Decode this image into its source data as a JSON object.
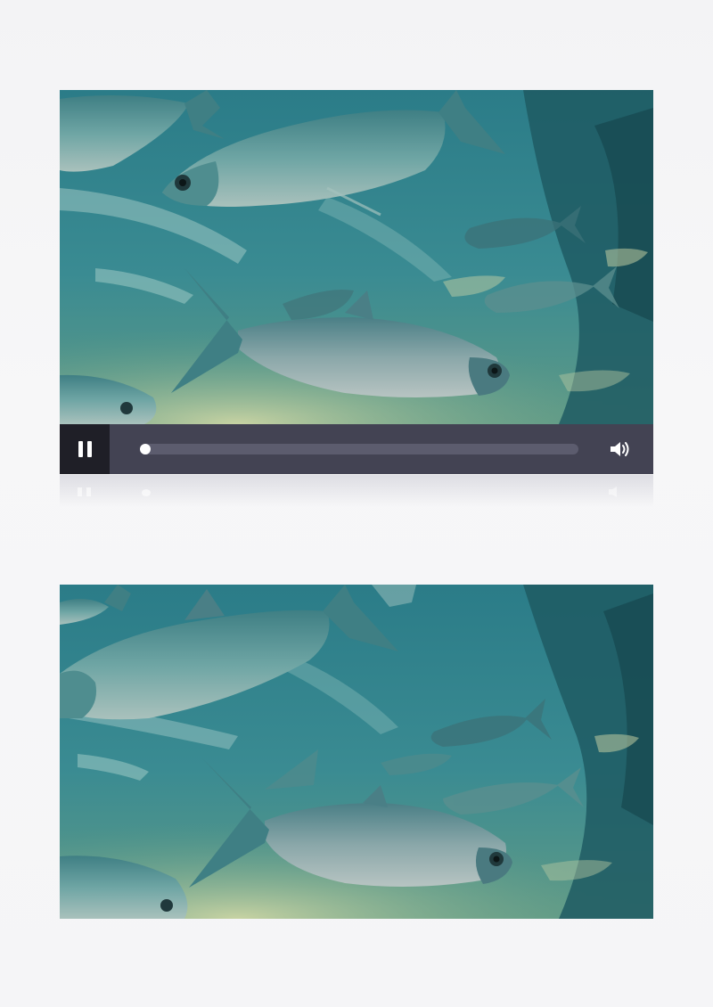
{
  "player": {
    "progress": 0,
    "icons": {
      "play_state": "pause-icon",
      "volume": "volume-icon"
    }
  },
  "scene": {
    "colors": {
      "water_top": "#2a7a86",
      "water_mid": "#3b8f96",
      "water_deep": "#1e5560",
      "sand": "#b9c79a",
      "fish_body": "#5d9a9c",
      "fish_belly": "#9ab8b4",
      "controls_bg": "#434353",
      "pause_bg": "#1f1f27"
    }
  }
}
